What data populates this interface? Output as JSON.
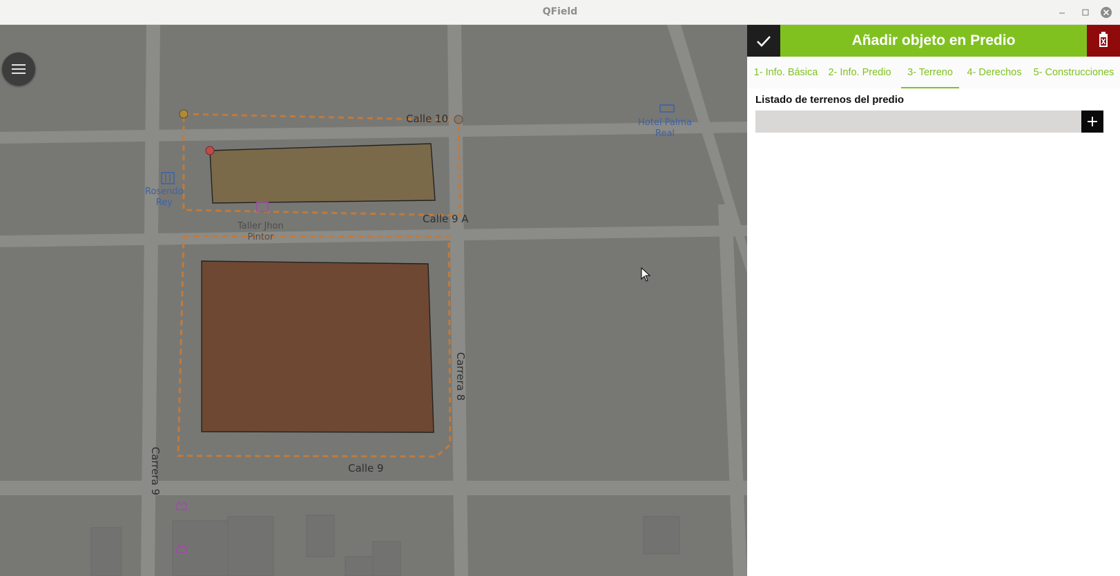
{
  "window": {
    "title": "QField"
  },
  "map": {
    "streets": [
      "Calle 10",
      "Calle 9 A",
      "Calle 9",
      "Carrera 8",
      "Carrera 9"
    ],
    "pois": {
      "rosendo": "Rosendo\nRey",
      "hotel": "Hotel Palma\nReal",
      "taller": "Taller Jhon\nPintor"
    }
  },
  "form": {
    "title": "Añadir objeto en Predio",
    "tabs": [
      "1- Info. Básica",
      "2- Info. Predio",
      "3- Terreno",
      "4- Derechos",
      "5- Construcciones"
    ],
    "active_tab": "3- Terreno",
    "section_label": "Listado de terrenos del predio"
  },
  "colors": {
    "accent": "#80c120",
    "confirm": "#1e1e1e",
    "delete": "#8f0b0b",
    "parcel_small": "#7a6a4a",
    "parcel_large": "#6e4832",
    "boundary_dash": "#c27a3a"
  },
  "icons": [
    "hamburger-menu-icon",
    "check-icon",
    "trash-icon",
    "plus-icon",
    "minimize-icon",
    "maximize-icon",
    "close-icon",
    "mouse-cursor-icon"
  ]
}
